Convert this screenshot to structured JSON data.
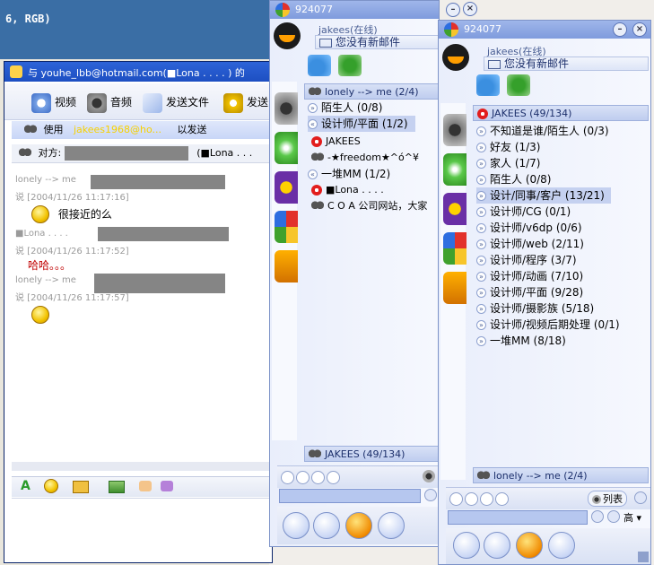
{
  "background": {
    "strip_text": "6, RGB)"
  },
  "chat": {
    "title": "与 youhe_lbb@hotmail.com(■Lona . . . . ) 的",
    "toolbar": {
      "video": "视频",
      "audio": "音频",
      "send_file": "发送文件",
      "send_more": "发送"
    },
    "using_prefix": "使用",
    "using_account": "jakees1968@ho...",
    "using_suffix": "以发送",
    "peer_label": "对方:",
    "peer_name": "(■Lona . . .",
    "messages": [
      {
        "meta_name": "lonely --> me",
        "meta_time": "说 [2004/11/26 11:17:16]",
        "text": "很接近的么"
      },
      {
        "meta_name": "■Lona . . . .",
        "meta_time": "说 [2004/11/26 11:17:52]",
        "text": "哈哈。。。"
      },
      {
        "meta_name": "lonely --> me",
        "meta_time": "说 [2004/11/26 11:17:57]",
        "text": ""
      }
    ]
  },
  "panel1": {
    "number": "924077",
    "user": "jakees(在线)",
    "mail": "您没有新邮件",
    "header": "lonely --> me (2/4)",
    "groups": [
      {
        "label": "陌生人 (0/8)",
        "selected": false,
        "chev": "»"
      },
      {
        "label": "设计师/平面 (1/2)",
        "selected": true,
        "chev": "«"
      }
    ],
    "contacts_a": [
      "JAKEES",
      "-★freedom★^ó^¥"
    ],
    "group2": {
      "label": "一堆MM (1/2)",
      "chev": "«"
    },
    "contacts_b": [
      "■Lona . . . .",
      "C O A 公司网站，大家"
    ],
    "footer": "JAKEES (49/134)"
  },
  "panel2": {
    "number": "924077",
    "user": "jakees(在线)",
    "mail": "您没有新邮件",
    "header": "JAKEES (49/134)",
    "groups": [
      {
        "label": "不知道是谁/陌生人 (0/3)",
        "selected": false
      },
      {
        "label": "好友 (1/3)",
        "selected": false
      },
      {
        "label": "家人 (1/7)",
        "selected": false
      },
      {
        "label": "陌生人 (0/8)",
        "selected": false
      },
      {
        "label": "设计/同事/客户 (13/21)",
        "selected": true
      },
      {
        "label": "设计师/CG (0/1)",
        "selected": false
      },
      {
        "label": "设计师/v6dp (0/6)",
        "selected": false
      },
      {
        "label": "设计师/web (2/11)",
        "selected": false
      },
      {
        "label": "设计师/程序 (3/7)",
        "selected": false
      },
      {
        "label": "设计师/动画 (7/10)",
        "selected": false
      },
      {
        "label": "设计师/平面 (9/28)",
        "selected": false
      },
      {
        "label": "设计师/摄影族 (5/18)",
        "selected": false
      },
      {
        "label": "设计师/视频后期处理 (0/1)",
        "selected": false
      },
      {
        "label": "一堆MM (8/18)",
        "selected": false
      }
    ],
    "footer": "lonely --> me (2/4)",
    "list_label": "列表",
    "ime_label": "高"
  }
}
